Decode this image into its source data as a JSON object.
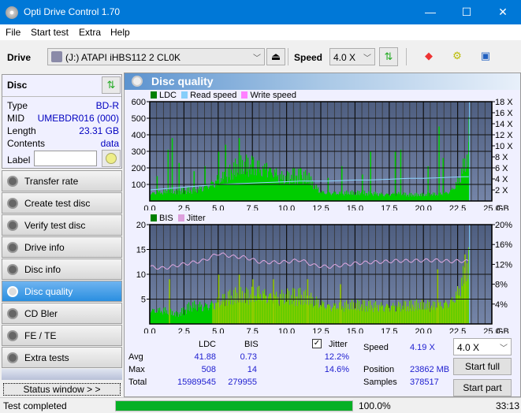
{
  "window": {
    "title": "Opti Drive Control 1.70",
    "minimize": "—",
    "maximize": "☐",
    "close": "✕"
  },
  "menu": [
    "File",
    "Start test",
    "Extra",
    "Help"
  ],
  "toolbar": {
    "drive_label": "Drive",
    "drive_value": "(J:)  ATAPI iHBS112  2 CL0K",
    "speed_label": "Speed",
    "speed_value": "4.0 X"
  },
  "disc": {
    "header": "Disc",
    "rows": [
      {
        "k": "Type",
        "v": "BD-R"
      },
      {
        "k": "MID",
        "v": "UMEBDR016 (000)"
      },
      {
        "k": "Length",
        "v": "23.31 GB"
      },
      {
        "k": "Contents",
        "v": "data"
      }
    ],
    "label_key": "Label",
    "label_value": ""
  },
  "nav": [
    {
      "label": "Transfer rate",
      "active": false
    },
    {
      "label": "Create test disc",
      "active": false
    },
    {
      "label": "Verify test disc",
      "active": false
    },
    {
      "label": "Drive info",
      "active": false
    },
    {
      "label": "Disc info",
      "active": false
    },
    {
      "label": "Disc quality",
      "active": true
    },
    {
      "label": "CD Bler",
      "active": false
    },
    {
      "label": "FE / TE",
      "active": false
    },
    {
      "label": "Extra tests",
      "active": false
    }
  ],
  "status_window_label": "Status window > >",
  "panel_title": "Disc quality",
  "chart_data": [
    {
      "type": "area",
      "title": "LDC / Read speed",
      "legend": [
        "LDC",
        "Read speed",
        "Write speed"
      ],
      "legend_colors": [
        "#008000",
        "#87cefa",
        "#ff80ff"
      ],
      "xlabel": "GB",
      "x_ticks": [
        "0.0",
        "2.5",
        "5.0",
        "7.5",
        "10.0",
        "12.5",
        "15.0",
        "17.5",
        "20.0",
        "22.5",
        "25.0"
      ],
      "xlim": [
        0,
        25
      ],
      "y_left_ticks": [
        "100",
        "200",
        "300",
        "400",
        "500",
        "600"
      ],
      "ylim_left": [
        0,
        600
      ],
      "y_right_ticks": [
        "2 X",
        "4 X",
        "6 X",
        "8 X",
        "10 X",
        "12 X",
        "14 X",
        "16 X",
        "18 X"
      ],
      "ylim_right": [
        0,
        18
      ],
      "ldc_x": [
        0,
        0.5,
        1,
        1.5,
        2,
        2.5,
        3,
        3.5,
        4,
        4.5,
        5,
        5.5,
        6,
        6.5,
        7,
        7.5,
        8,
        8.5,
        9,
        9.5,
        10,
        10.5,
        11,
        11.5,
        12,
        12.5,
        13,
        13.5,
        14,
        14.5,
        15,
        15.5,
        16,
        16.5,
        17,
        17.5,
        18,
        18.5,
        19,
        19.5,
        20,
        20.5,
        21,
        21.5,
        22,
        22.5,
        23,
        23.31
      ],
      "ldc_y": [
        50,
        55,
        60,
        65,
        55,
        70,
        70,
        75,
        100,
        120,
        150,
        160,
        200,
        220,
        230,
        235,
        220,
        210,
        200,
        160,
        150,
        170,
        160,
        150,
        100,
        60,
        55,
        55,
        50,
        55,
        50,
        55,
        50,
        50,
        45,
        45,
        50,
        45,
        40,
        40,
        40,
        45,
        45,
        50,
        70,
        130,
        250,
        300
      ],
      "ldc_spikes": [
        [
          0.5,
          150
        ],
        [
          1.3,
          310
        ],
        [
          1.6,
          380
        ],
        [
          2.1,
          230
        ],
        [
          3.2,
          180
        ],
        [
          4,
          210
        ],
        [
          5,
          300
        ],
        [
          5.5,
          340
        ],
        [
          6.5,
          380
        ],
        [
          7.5,
          250
        ],
        [
          8.5,
          230
        ],
        [
          11,
          200
        ],
        [
          11.6,
          170
        ],
        [
          13,
          140
        ],
        [
          14,
          210
        ],
        [
          15.5,
          160
        ],
        [
          16.1,
          300
        ],
        [
          17.9,
          300
        ],
        [
          18.3,
          310
        ],
        [
          20.3,
          210
        ],
        [
          21.1,
          450
        ],
        [
          21.4,
          260
        ],
        [
          23.3,
          508
        ]
      ],
      "read_speed_x": [
        0,
        1,
        2,
        3,
        4,
        5,
        6,
        7,
        8,
        9,
        10,
        11,
        12,
        13,
        14,
        15,
        16,
        17,
        18,
        19,
        20,
        21,
        22,
        23,
        23.31
      ],
      "read_speed_y": [
        2.0,
        2.2,
        2.4,
        2.6,
        2.8,
        3.0,
        3.1,
        3.2,
        3.3,
        3.4,
        3.5,
        3.6,
        3.6,
        3.6,
        3.7,
        3.8,
        3.8,
        3.9,
        4.0,
        4.1,
        4.1,
        4.2,
        4.3,
        4.4,
        4.4
      ]
    },
    {
      "type": "area",
      "title": "BIS / Jitter",
      "legend": [
        "BIS",
        "Jitter"
      ],
      "legend_colors": [
        "#008000",
        "#dda0dd"
      ],
      "xlabel": "GB",
      "x_ticks": [
        "0.0",
        "2.5",
        "5.0",
        "7.5",
        "10.0",
        "12.5",
        "15.0",
        "17.5",
        "20.0",
        "22.5",
        "25.0"
      ],
      "xlim": [
        0,
        25
      ],
      "y_left_ticks": [
        "5",
        "10",
        "15",
        "20"
      ],
      "ylim_left": [
        0,
        20
      ],
      "y_right_ticks": [
        "4%",
        "8%",
        "12%",
        "16%",
        "20%"
      ],
      "ylim_right": [
        0,
        20
      ],
      "bis_x": [
        0,
        1,
        2,
        3,
        4,
        5,
        6,
        7,
        8,
        9,
        10,
        11,
        12,
        13,
        14,
        15,
        16,
        17,
        18,
        19,
        20,
        21,
        22,
        22.5,
        23,
        23.31
      ],
      "bis_y": [
        3,
        3,
        2,
        4,
        4,
        5,
        6,
        6,
        7,
        6,
        6,
        6,
        5,
        4,
        4,
        4,
        4,
        4,
        4,
        4,
        4,
        4,
        5,
        7,
        11,
        13
      ],
      "bis_spikes": [
        [
          1.4,
          9
        ],
        [
          5,
          10
        ],
        [
          6.5,
          10
        ],
        [
          7.5,
          9
        ],
        [
          9,
          9
        ],
        [
          11.5,
          9
        ],
        [
          13.9,
          8
        ],
        [
          21,
          11
        ],
        [
          23,
          14
        ]
      ],
      "jitter_x": [
        0,
        1,
        2,
        3,
        4,
        5,
        6,
        7,
        8,
        9,
        10,
        11,
        12,
        13,
        14,
        15,
        16,
        17,
        18,
        19,
        20,
        21,
        22,
        23,
        23.31
      ],
      "jitter_y": [
        11.5,
        11.2,
        11.8,
        12.3,
        12.8,
        14.2,
        13.6,
        13.4,
        12.5,
        12.4,
        12.5,
        12.9,
        11.8,
        11.5,
        11.8,
        12.2,
        12.4,
        12.5,
        12.7,
        12.7,
        12.8,
        12.8,
        12.6,
        12.7,
        12.5
      ]
    }
  ],
  "stats": {
    "col_ldc": "LDC",
    "col_bis": "BIS",
    "jitter_label": "Jitter",
    "jitter_checked": true,
    "rows": [
      {
        "k": "Avg",
        "ldc": "41.88",
        "bis": "0.73",
        "jit": "12.2%"
      },
      {
        "k": "Max",
        "ldc": "508",
        "bis": "14",
        "jit": "14.6%"
      },
      {
        "k": "Total",
        "ldc": "15989545",
        "bis": "279955",
        "jit": ""
      }
    ],
    "speed_label": "Speed",
    "speed_value": "4.19 X",
    "position_label": "Position",
    "position_value": "23862 MB",
    "samples_label": "Samples",
    "samples_value": "378517",
    "speed_select": "4.0 X",
    "start_full": "Start full",
    "start_part": "Start part"
  },
  "statusbar": {
    "text": "Test completed",
    "progress": 100.0,
    "progress_text": "100.0%",
    "time": "33:13"
  }
}
